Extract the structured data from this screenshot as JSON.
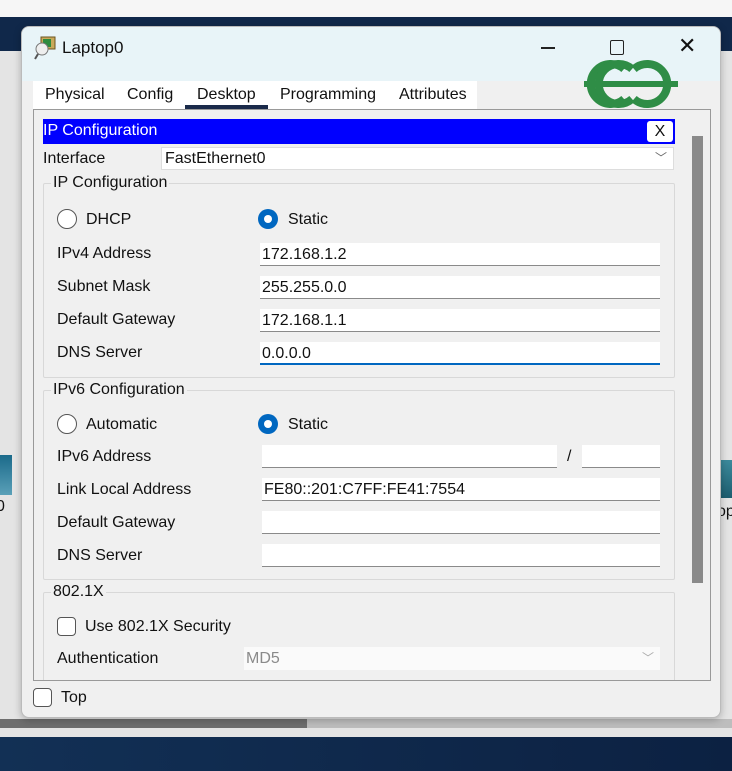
{
  "window": {
    "title": "Laptop0",
    "logo": "GeeksforGeeks GG logo"
  },
  "tabs": [
    {
      "label": "Physical"
    },
    {
      "label": "Config"
    },
    {
      "label": "Desktop",
      "active": true
    },
    {
      "label": "Programming"
    },
    {
      "label": "Attributes"
    }
  ],
  "panel": {
    "title": "IP Configuration",
    "close_label": "X",
    "header_color": "#0000ff"
  },
  "interface": {
    "label": "Interface",
    "value": "FastEthernet0"
  },
  "ipv4": {
    "legend": "IP Configuration",
    "dhcp_label": "DHCP",
    "static_label": "Static",
    "mode": "Static",
    "rows": [
      {
        "label": "IPv4 Address",
        "value": "172.168.1.2"
      },
      {
        "label": "Subnet Mask",
        "value": "255.255.0.0"
      },
      {
        "label": "Default Gateway",
        "value": "172.168.1.1"
      },
      {
        "label": "DNS Server",
        "value": "0.0.0.0"
      }
    ]
  },
  "ipv6": {
    "legend": "IPv6 Configuration",
    "auto_label": "Automatic",
    "static_label": "Static",
    "mode": "Static",
    "address_label": "IPv6 Address",
    "address_value": "",
    "slash": "/",
    "prefix_value": "",
    "rows": [
      {
        "label": "Link Local Address",
        "value": "FE80::201:C7FF:FE41:7554"
      },
      {
        "label": "Default Gateway",
        "value": ""
      },
      {
        "label": "DNS Server",
        "value": ""
      }
    ]
  },
  "dot1x": {
    "legend": "802.1X",
    "use_label": "Use 802.1X Security",
    "checked": false,
    "auth_label": "Authentication",
    "auth_value": "MD5"
  },
  "footer": {
    "top_label": "Top",
    "checked": false
  },
  "background": {
    "left_icon_label": "0",
    "right_icon_label": "op"
  }
}
